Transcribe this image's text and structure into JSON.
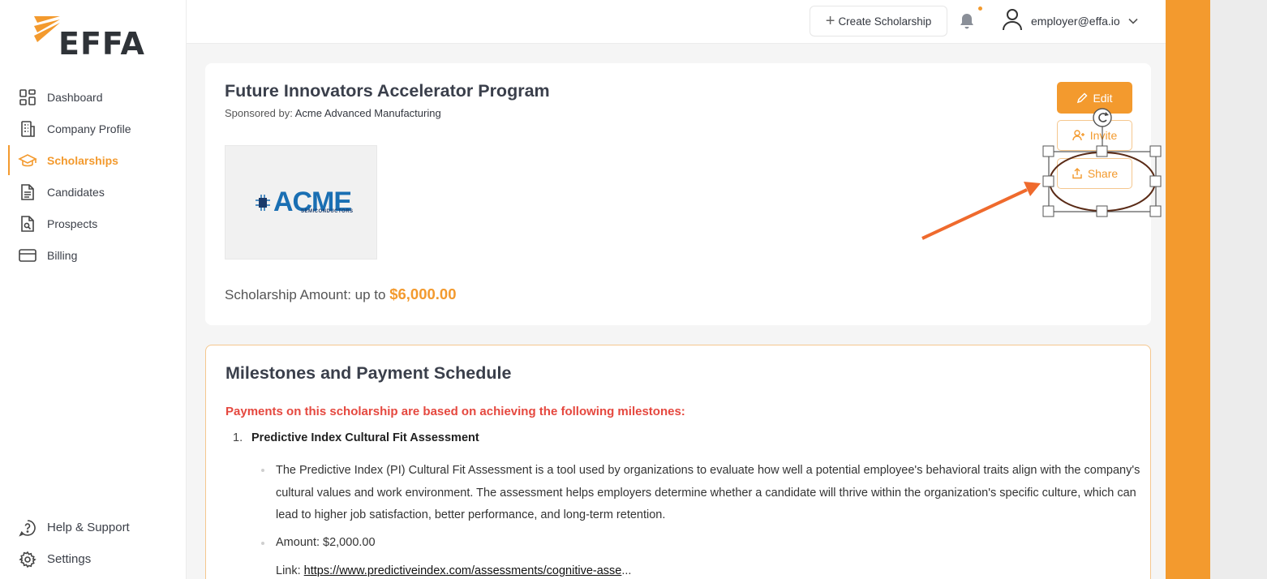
{
  "brand": {
    "logo_text": "EFFA",
    "accent": "#f39a2e"
  },
  "sidebar": {
    "items": [
      {
        "label": "Dashboard",
        "icon": "dashboard-icon"
      },
      {
        "label": "Company Profile",
        "icon": "building-icon"
      },
      {
        "label": "Scholarships",
        "icon": "graduation-cap-icon",
        "active": true
      },
      {
        "label": "Candidates",
        "icon": "document-icon"
      },
      {
        "label": "Prospects",
        "icon": "search-document-icon"
      },
      {
        "label": "Billing",
        "icon": "credit-card-icon"
      }
    ],
    "bottom": [
      {
        "label": "Help & Support",
        "icon": "help-icon"
      },
      {
        "label": "Settings",
        "icon": "gear-icon"
      }
    ]
  },
  "topbar": {
    "create_label": "Create Scholarship",
    "user_email": "employer@effa.io"
  },
  "scholarship": {
    "title": "Future Innovators Accelerator Program",
    "sponsor_prefix": "Sponsored by:",
    "sponsor_name": "Acme Advanced Manufacturing",
    "logo_word": "ACME",
    "logo_sub": "SEMICONDUCTORS",
    "amount_prefix": "Scholarship Amount: up to",
    "amount_value": "$6,000.00",
    "actions": {
      "edit": "Edit",
      "invite": "Invite",
      "share": "Share"
    }
  },
  "milestones": {
    "title": "Milestones and Payment Schedule",
    "note": "Payments on this scholarship are based on achieving the following milestones:",
    "items": [
      {
        "number": "1.",
        "name": "Predictive Index Cultural Fit Assessment",
        "description": "The Predictive Index (PI) Cultural Fit Assessment is a tool used by organizations to evaluate how well a potential employee's behavioral traits align with the company's cultural values and work environment. The assessment helps employers determine whether a candidate will thrive within the organization's specific culture, which can lead to higher job satisfaction, better performance, and long-term retention.",
        "amount": "Amount: $2,000.00",
        "link_prefix": "Link:",
        "link_text": "https://www.predictiveindex.com/assessments/cognitive-asse",
        "link_suffix": "..."
      }
    ]
  }
}
